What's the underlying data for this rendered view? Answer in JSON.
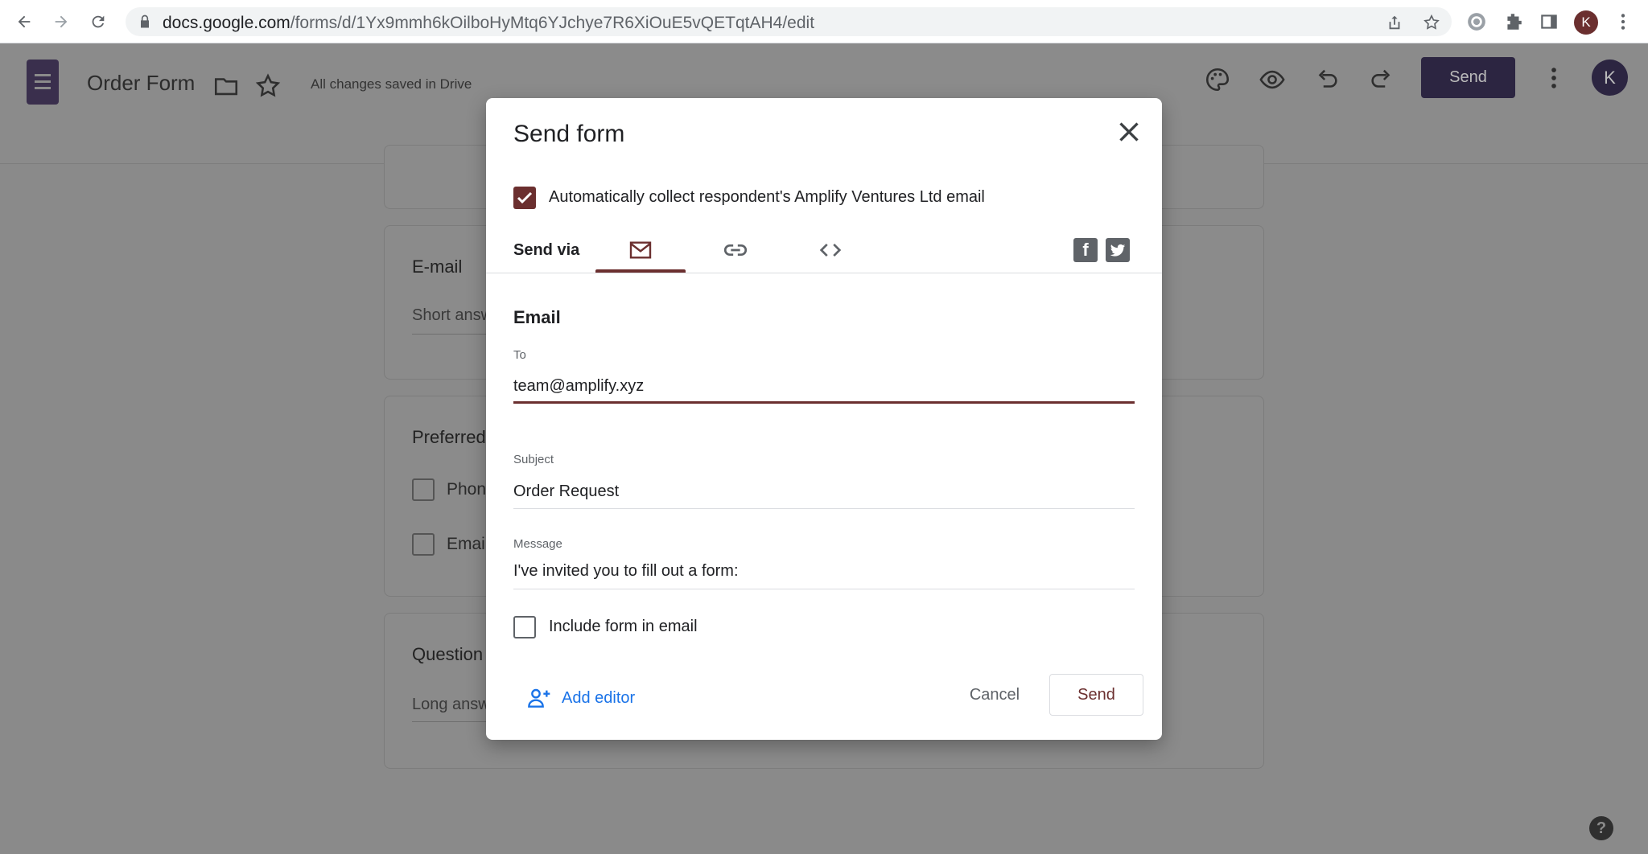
{
  "browser": {
    "url_host": "docs.google.com",
    "url_path": "/forms/d/1Yx9mmh6kOilboHyMtq6YJchye7R6XiOuE5vQETqtAH4/edit",
    "profile_initial": "K"
  },
  "header": {
    "doc_title": "Order Form",
    "save_status": "All changes saved in Drive",
    "send_label": "Send",
    "avatar_initial": "K"
  },
  "background_cards": {
    "email_title": "E-mail",
    "email_hint": "Short answ",
    "preferred_title": "Preferred",
    "preferred_options": [
      "Phon",
      "Email"
    ],
    "question_title": "Question",
    "question_hint": "Long answ"
  },
  "help_label": "?",
  "dialog": {
    "title": "Send form",
    "auto_collect_label": "Automatically collect respondent's Amplify Ventures Ltd email",
    "auto_collect_checked": true,
    "send_via_label": "Send via",
    "active_tab": "email",
    "section_title": "Email",
    "to_label": "To",
    "to_value": "team@amplify.xyz",
    "subject_label": "Subject",
    "subject_value": "Order Request",
    "message_label": "Message",
    "message_value": "I've invited you to fill out a form:",
    "include_form_label": "Include form in email",
    "include_form_checked": false,
    "add_editor_label": "Add editor",
    "cancel_label": "Cancel",
    "send_label": "Send"
  },
  "colors": {
    "accent": "#6b2f2f",
    "link": "#1a73e8",
    "overlay_bg": "#8a8a8a"
  }
}
